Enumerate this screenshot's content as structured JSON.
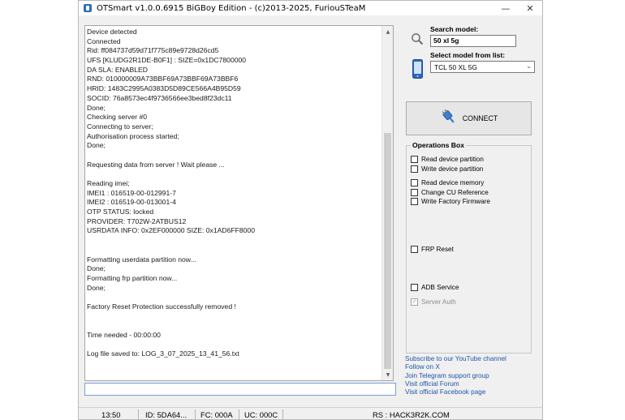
{
  "window": {
    "title": "OTSmart  v1.0.0.6915 BiGBoy Edition - (c)2013-2025, FuriouSTeaM",
    "minimize_glyph": "—",
    "close_glyph": "✕"
  },
  "log": {
    "lines": [
      "Device detected",
      "Connected",
      "Rid: ff084737d59d71f775c89e9728d26cd5",
      "UFS [KLUDG2R1DE-B0F1] : SIZE=0x1DC7800000",
      "DA SLA: ENABLED",
      "RND: 010000009A73BBF69A73BBF69A73BBF6",
      "HRID: 1483C2995A0383D5D89CE566A4B95D59",
      "SOCID: 76a8573ec4f9736566ee3bed8f23dc11",
      "Done;",
      "Checking server #0",
      "Connecting to server;",
      "Authorisation process started;",
      "Done;",
      "",
      "Requesting data from server ! Wait please ...",
      "",
      "Reading imei;",
      "IMEI1 : 016519-00-012991-7",
      "IMEI2 : 016519-00-013001-4",
      "OTP STATUS: locked",
      "PROVIDER: T702W-2ATBUS12",
      "USRDATA INFO: 0x2EF000000 SIZE: 0x1AD6FF8000",
      "",
      "",
      "Formatting userdata partition now...",
      "Done;",
      "Formatting frp partition now...",
      "Done;",
      "",
      "Factory Reset Protection successfully removed !",
      "",
      "",
      "Time needed - 00:00:00",
      "",
      "Log file saved to: LOG_3_07_2025_13_41_56.txt"
    ],
    "scroll_up_glyph": "▲",
    "scroll_down_glyph": "▼"
  },
  "command_input": {
    "value": ""
  },
  "search": {
    "label": "Search model:",
    "value": "50 xl 5g",
    "icon": "magnifier-icon"
  },
  "model_select": {
    "label": "Select model from list:",
    "selected": "TCL 50 XL 5G",
    "arrow_glyph": "⌄",
    "icon": "phone-icon"
  },
  "connect": {
    "label": "CONNECT",
    "icon": "plug-icon"
  },
  "operations": {
    "title": "Operations Box",
    "items": [
      {
        "label": "Read device partition",
        "checked": false,
        "enabled": true
      },
      {
        "label": "Write device partition",
        "checked": false,
        "enabled": true
      },
      {
        "label": "Read device memory",
        "checked": false,
        "enabled": true
      },
      {
        "label": "Change CU Reference",
        "checked": false,
        "enabled": true
      },
      {
        "label": "Write Factory Firmware",
        "checked": false,
        "enabled": true
      },
      {
        "label": "FRP Reset",
        "checked": false,
        "enabled": true
      },
      {
        "label": "ADB Service",
        "checked": false,
        "enabled": true
      },
      {
        "label": "Server Auth",
        "checked": true,
        "enabled": false
      }
    ],
    "check_glyph": "✓"
  },
  "links": [
    "Subscribe to our YouTube channel",
    "Follow on X",
    "Join Telegram support group",
    "Visit official Forum",
    "Visit official Facebook page"
  ],
  "statusbar": {
    "time": "13:50",
    "id": "ID: 5DA64...",
    "fc": "FC: 000A",
    "uc": "UC: 000C",
    "rs": "RS : HACK3R2K.COM"
  },
  "colors": {
    "link": "#1f55a8",
    "window_bg": "#f0f0f0",
    "plug_blue": "#3b7fd0"
  }
}
